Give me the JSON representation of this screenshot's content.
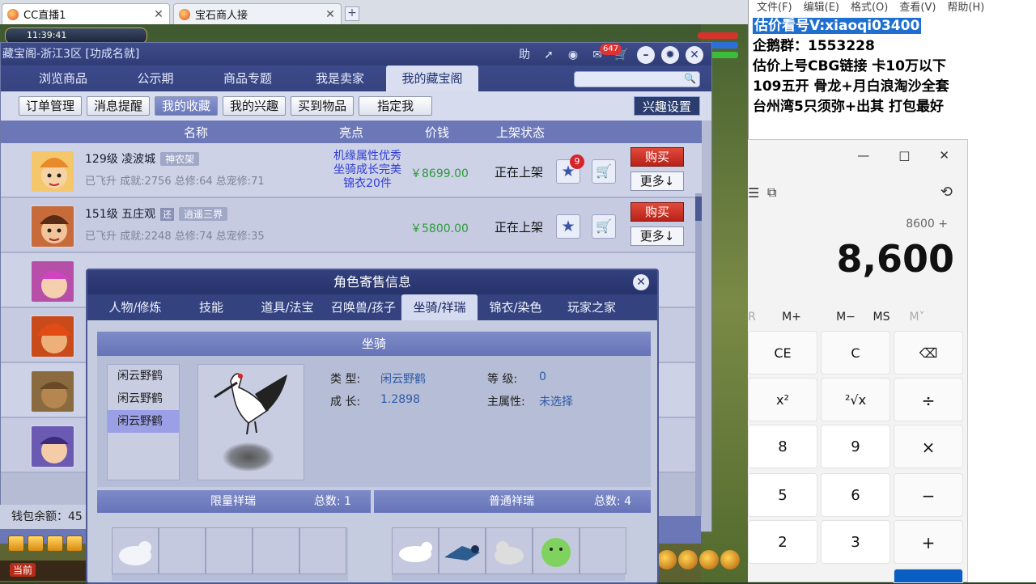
{
  "browser": {
    "tabs": [
      {
        "title": "CC直播1",
        "close": "✕"
      },
      {
        "title": "宝石商人接",
        "close": "✕"
      }
    ],
    "new_tab": "+"
  },
  "game": {
    "status_text": "11:39:41",
    "window_title": "藏宝阁-浙江3区 [功成名就]",
    "title_icons": {
      "help": "助",
      "badge": "647"
    },
    "nav_tabs": [
      "浏览商品",
      "公示期",
      "商品专题",
      "我是卖家",
      "我的藏宝阁"
    ],
    "nav_active": "我的藏宝阁",
    "sub_buttons": [
      "订单管理",
      "消息提醒",
      "我的收藏",
      "我的兴趣",
      "买到物品",
      "指定我"
    ],
    "sub_active": "我的收藏",
    "interest_settings": "兴趣设置",
    "table_headers": {
      "name": "名称",
      "highlight": "亮点",
      "price": "价钱",
      "status": "上架状态"
    },
    "rows": [
      {
        "name": "129级 凌波城",
        "tag": "神农架",
        "sub": "已飞升 成就:2756 总修:64 总宠修:71",
        "highlight": [
          "机缘属性优秀",
          "坐骑成长完美",
          "锦衣20件"
        ],
        "price": "￥8699.00",
        "status": "正在上架",
        "stars": "9",
        "buy": "购买",
        "more": "更多↓"
      },
      {
        "name": "151级 五庄观",
        "tag2": "还",
        "tag": "逍遥三界",
        "sub": "已飞升 成就:2248 总修:74 总宠修:35",
        "highlight": [],
        "price": "￥5800.00",
        "status": "正在上架",
        "buy": "购买",
        "more": "更多↓"
      }
    ],
    "wallet_label": "钱包余额：45",
    "current_tag": "当前"
  },
  "modal": {
    "title": "角色寄售信息",
    "close": "✕",
    "tabs": [
      "人物/修炼",
      "技能",
      "道具/法宝",
      "召唤兽/孩子",
      "坐骑/祥瑞",
      "锦衣/染色",
      "玩家之家"
    ],
    "active_tab": "坐骑/祥瑞",
    "section": "坐骑",
    "mounts": [
      "闲云野鹤",
      "闲云野鹤",
      "闲云野鹤"
    ],
    "attrs": {
      "type_label": "类    型:",
      "type_value": "闲云野鹤",
      "growth_label": "成    长:",
      "growth_value": "1.2898",
      "level_label": "等    级:",
      "level_value": "0",
      "main_attr_label": "主属性:",
      "main_attr_value": "未选择"
    },
    "limited": {
      "title": "限量祥瑞",
      "total": "总数:  1"
    },
    "normal": {
      "title": "普通祥瑞",
      "total": "总数:  4"
    }
  },
  "notepad": {
    "menu": [
      "文件(F)",
      "编辑(E)",
      "格式(O)",
      "查看(V)",
      "帮助(H)"
    ],
    "lines": [
      "估价看号V:xiaoqi03400",
      "企鹅群：1553228",
      "估价上号CBG链接 卡10万以下",
      "109五开 骨龙+月白浪淘沙全套",
      "台州湾5只须弥+出其 打包最好"
    ]
  },
  "calculator": {
    "window_buttons": [
      "—",
      "□",
      "✕"
    ],
    "expression": "8600 +",
    "display": "8,600",
    "memory": [
      "R",
      "M+",
      "M−",
      "MS",
      "M˅"
    ],
    "keys": [
      "CE",
      "C",
      "⌫",
      "x²",
      "²√x",
      "÷",
      "8",
      "9",
      "×",
      "5",
      "6",
      "−",
      "2",
      "3",
      "+"
    ]
  },
  "colors": {
    "accent": "#2f3c76",
    "price_green": "#2c9a3a",
    "buy_red": "#c8281b",
    "highlight_blue": "#2f3dd4",
    "calc_equals": "#0a5dc2"
  }
}
